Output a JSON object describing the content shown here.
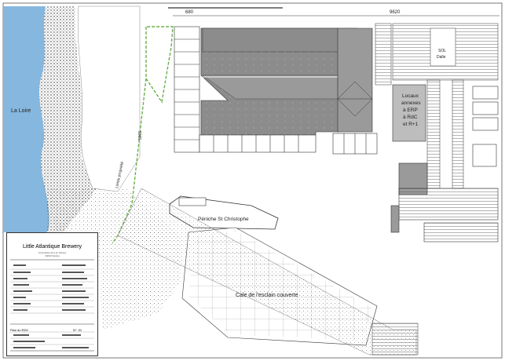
{
  "dimensions": {
    "top_short": "680",
    "top_long": "9620",
    "side": "5065"
  },
  "labels": {
    "river": "La Loire",
    "boat": "Péniche St Christophe",
    "covered_slip": "Cale de l'esclain couverte",
    "annexes": [
      "Locaux",
      "annexes",
      "à ERP",
      "à RdC",
      "et R+1"
    ],
    "upper_block": [
      "SOL",
      "Dalle"
    ],
    "limit": "Limite propriété"
  },
  "title_block": {
    "title": "Little Atlantique Brewery",
    "subtitle_1": "Arrondissement de Nantes",
    "subtitle_2": "44000 Nantes",
    "plan_label": "Plan du RDC",
    "plan_number": "N°: 01"
  },
  "colors": {
    "water": "#86b7de",
    "concrete": "#8a8a8a",
    "limit_line": "#6ab04c",
    "ink": "#333333"
  }
}
